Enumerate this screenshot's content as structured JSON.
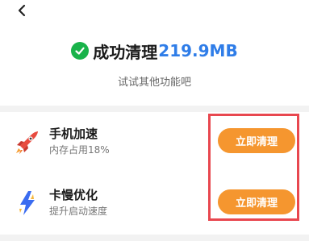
{
  "header": {
    "back_icon": "chevron-left-icon",
    "title": "成功清理",
    "amount": "219.9MB",
    "subtitle": "试试其他功能吧"
  },
  "colors": {
    "accent_green": "#19b34a",
    "accent_blue": "#2f7de8",
    "button_orange": "#f5962f",
    "highlight_red": "#e8474f"
  },
  "features": [
    {
      "icon": "rocket-icon",
      "title": "手机加速",
      "subtitle": "内存占用18%",
      "button": "立即清理"
    },
    {
      "icon": "lightning-icon",
      "title": "卡慢优化",
      "subtitle": "提升启动速度",
      "button": "立即清理"
    }
  ]
}
